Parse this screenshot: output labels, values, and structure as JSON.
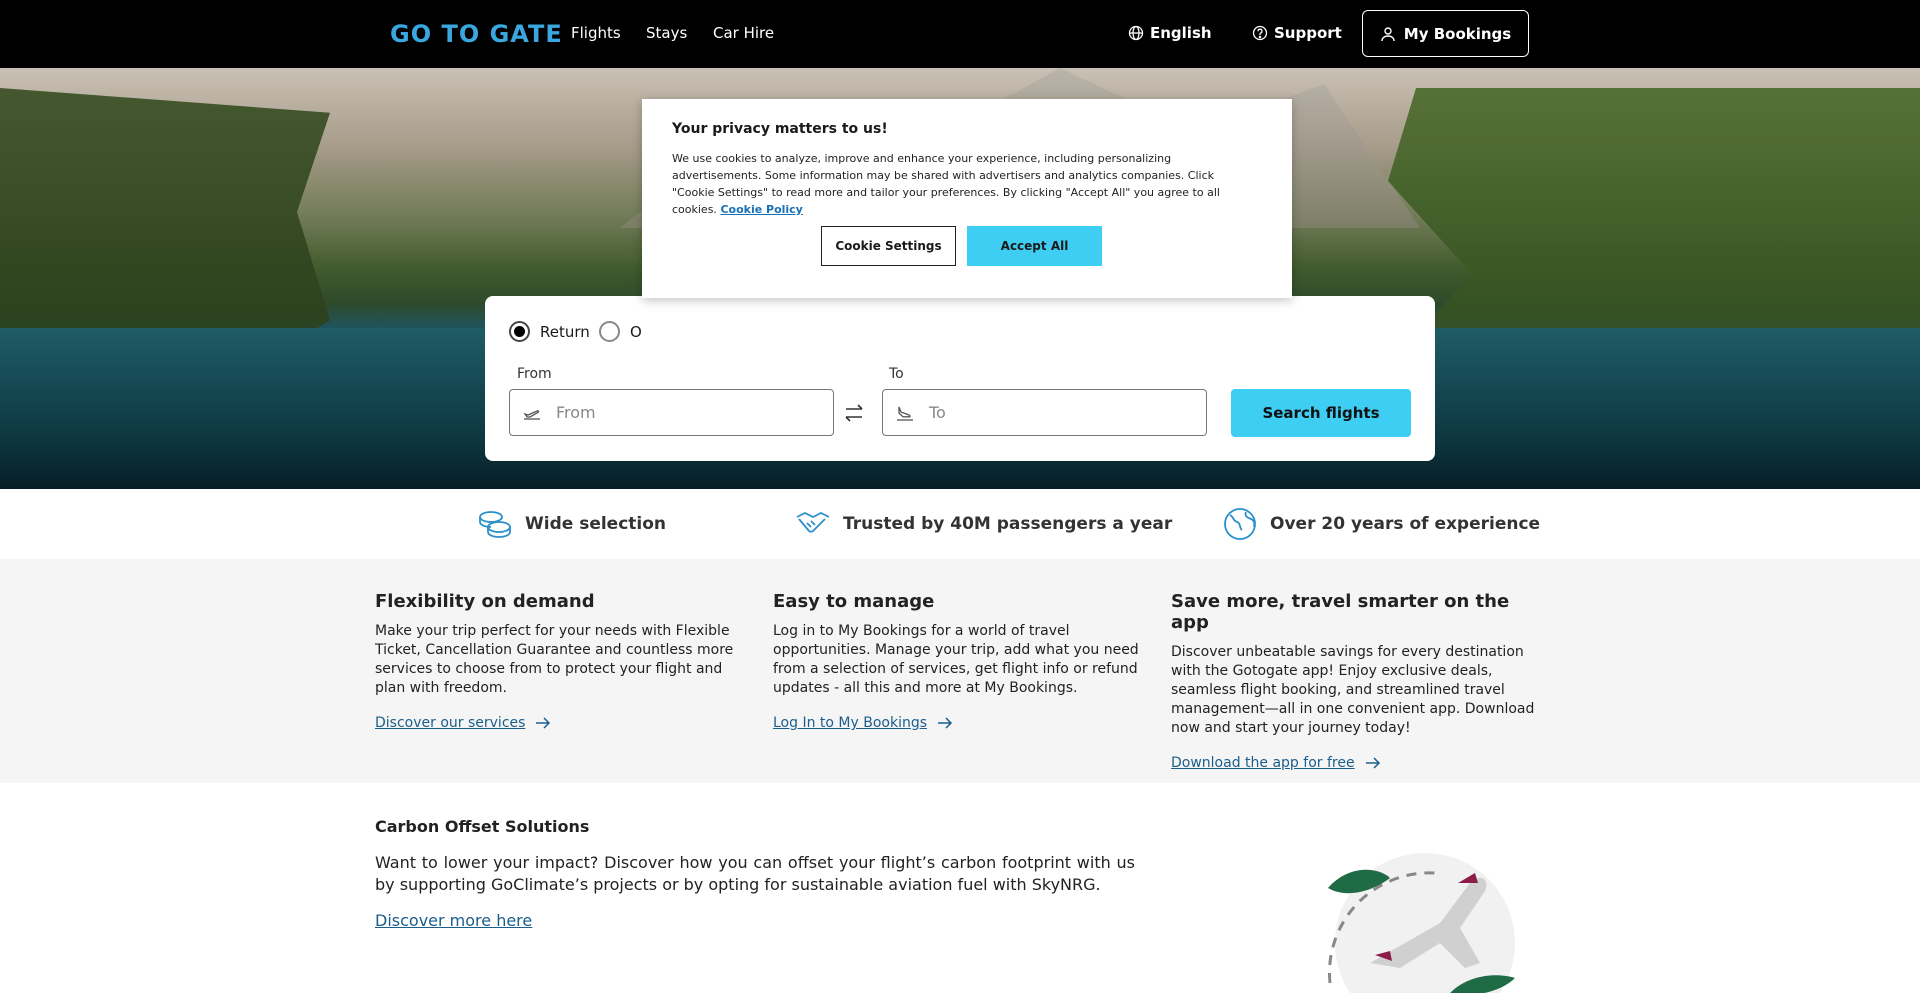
{
  "header": {
    "logo": "GO TO GATE",
    "nav": [
      "Flights",
      "Stays",
      "Car Hire"
    ],
    "language": "English",
    "support": "Support",
    "my_bookings": "My Bookings"
  },
  "search": {
    "trip_types": [
      "Return",
      "O"
    ],
    "selected_trip_type": "Return",
    "from_label": "From",
    "from_placeholder": "From",
    "to_label": "To",
    "to_placeholder": "To",
    "search_button": "Search flights"
  },
  "cookie": {
    "title": "Your privacy matters to us!",
    "body": "We use cookies to analyze, improve and enhance your experience, including personalizing advertisements. Some information may be shared with advertisers and analytics companies. Click \"Cookie Settings\" to read more and tailor your preferences. By clicking \"Accept All\" you agree to all cookies.",
    "policy_link": "Cookie Policy",
    "settings_button": "Cookie Settings",
    "accept_button": "Accept All"
  },
  "trust": [
    {
      "icon": "coins-icon",
      "text": "Wide selection"
    },
    {
      "icon": "handshake-icon",
      "text": "Trusted by 40M passengers a year"
    },
    {
      "icon": "globe-icon",
      "text": "Over 20 years of experience"
    }
  ],
  "features": [
    {
      "title": "Flexibility on demand",
      "body": "Make your trip perfect for your needs with Flexible Ticket, Cancellation Guarantee and countless more services to choose from to protect your flight and plan with freedom.",
      "link": "Discover our services"
    },
    {
      "title": "Easy to manage",
      "body": "Log in to My Bookings for a world of travel opportunities. Manage your trip, add what you need from a selection of services, get flight info or refund updates - all this and more at My Bookings.",
      "link": "Log In to My Bookings"
    },
    {
      "title": "Save more, travel smarter on the app",
      "body": "Discover unbeatable savings for every destination with the Gotogate app! Enjoy exclusive deals, seamless flight booking, and streamlined travel management—all in one convenient app. Download now and start your journey today!",
      "link": "Download the app for free"
    }
  ],
  "carbon": {
    "title": "Carbon Offset Solutions",
    "body": "Want to lower your impact? Discover how you can offset your flight’s carbon footprint with us by supporting GoClimate’s projects or by opting for sustainable aviation fuel with SkyNRG.",
    "link": "Discover more here"
  },
  "colors": {
    "accent": "#3ecdf3",
    "logo": "#3aa7e0",
    "link": "#1b5e8c",
    "leaf_green": "#1f6b45",
    "plane_accent": "#8b1d4a"
  }
}
